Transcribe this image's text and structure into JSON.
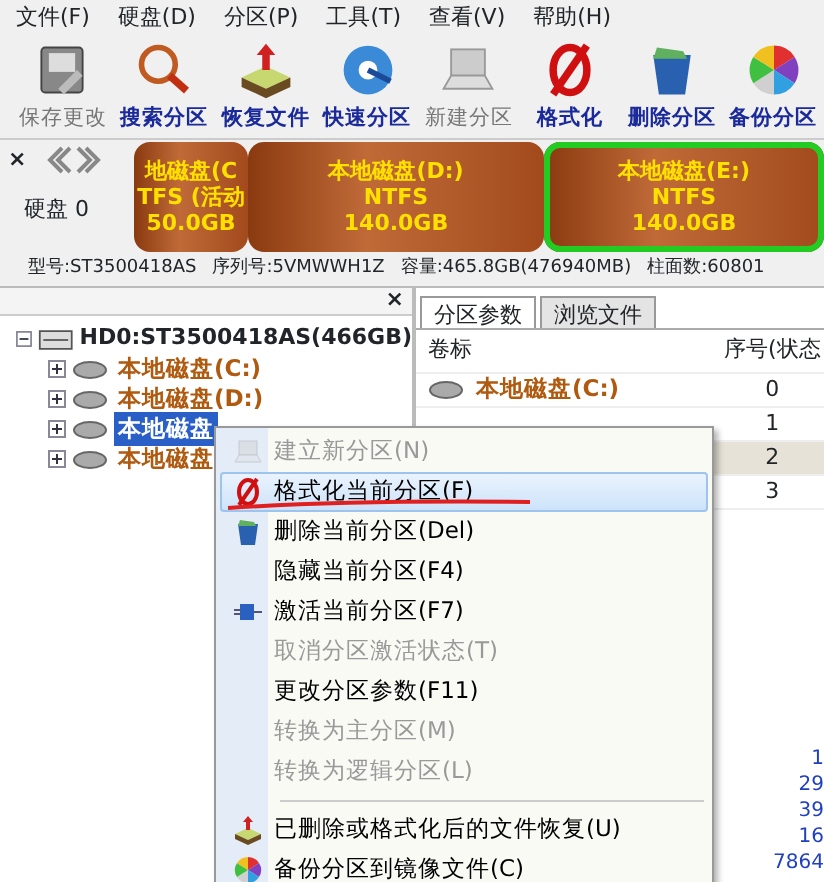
{
  "menu_bar": [
    "文件(F)",
    "硬盘(D)",
    "分区(P)",
    "工具(T)",
    "查看(V)",
    "帮助(H)"
  ],
  "toolbar": [
    {
      "label": "保存更改",
      "kind": "save",
      "disabled": true
    },
    {
      "label": "搜索分区",
      "kind": "search",
      "disabled": false
    },
    {
      "label": "恢复文件",
      "kind": "recover",
      "disabled": false
    },
    {
      "label": "快速分区",
      "kind": "quick",
      "disabled": false
    },
    {
      "label": "新建分区",
      "kind": "new",
      "disabled": true
    },
    {
      "label": "格式化",
      "kind": "format",
      "disabled": false
    },
    {
      "label": "删除分区",
      "kind": "delete",
      "disabled": false
    },
    {
      "label": "备份分区",
      "kind": "backup",
      "disabled": false
    }
  ],
  "disk_map": {
    "close": "×",
    "disk_label": "硬盘 0",
    "partitions": [
      {
        "name": "地磁盘(C",
        "fs": "TFS (活动",
        "size": "50.0GB",
        "selected": false
      },
      {
        "name": "本地磁盘(D:)",
        "fs": "NTFS",
        "size": "140.0GB",
        "selected": false
      },
      {
        "name": "本地磁盘(E:)",
        "fs": "NTFS",
        "size": "140.0GB",
        "selected": true
      }
    ]
  },
  "disk_info": [
    "型号:ST3500418AS",
    "序列号:5VMWWH1Z",
    "容量:465.8GB(476940MB)",
    "柱面数:60801"
  ],
  "tree": {
    "close": "×",
    "root": {
      "label": "HD0:ST3500418AS(466GB)",
      "expanded": true,
      "children": [
        {
          "label": "本地磁盘(C:)",
          "selected": false
        },
        {
          "label": "本地磁盘(D:)",
          "selected": false
        },
        {
          "label": "本地磁盘",
          "selected": true
        },
        {
          "label": "本地磁盘",
          "selected": false
        }
      ]
    }
  },
  "tabs": [
    {
      "label": "分区参数",
      "selected": true
    },
    {
      "label": "浏览文件",
      "selected": false
    }
  ],
  "table": {
    "columns": [
      "卷标",
      "序号(状态"
    ],
    "rows": [
      {
        "label": "本地磁盘(C:)",
        "index": "0",
        "selected": false
      },
      {
        "label": "",
        "index": "1",
        "selected": false
      },
      {
        "label": "",
        "index": "2",
        "selected": true
      },
      {
        "label": "",
        "index": "3",
        "selected": false
      }
    ]
  },
  "side_values": [
    "1",
    "29",
    "39",
    "16",
    "7864"
  ],
  "context_menu": [
    {
      "kind": "new",
      "label": "建立新分区(N)",
      "disabled": true,
      "selected": false
    },
    {
      "kind": "format",
      "label": "格式化当前分区(F)",
      "disabled": false,
      "selected": true
    },
    {
      "kind": "delete",
      "label": "删除当前分区(Del)",
      "disabled": false,
      "selected": false
    },
    {
      "kind": "plain",
      "label": "隐藏当前分区(F4)",
      "disabled": false,
      "selected": false
    },
    {
      "kind": "activate",
      "label": "激活当前分区(F7)",
      "disabled": false,
      "selected": false
    },
    {
      "kind": "plain",
      "label": "取消分区激活状态(T)",
      "disabled": true,
      "selected": false
    },
    {
      "kind": "plain",
      "label": "更改分区参数(F11)",
      "disabled": false,
      "selected": false
    },
    {
      "kind": "plain",
      "label": "转换为主分区(M)",
      "disabled": true,
      "selected": false
    },
    {
      "kind": "plain",
      "label": "转换为逻辑分区(L)",
      "disabled": true,
      "selected": false
    },
    {
      "kind": "separator"
    },
    {
      "kind": "recover",
      "label": "已删除或格式化后的文件恢复(U)",
      "disabled": false,
      "selected": false
    },
    {
      "kind": "backup",
      "label": "备份分区到镜像文件(C)",
      "disabled": false,
      "selected": false
    }
  ]
}
